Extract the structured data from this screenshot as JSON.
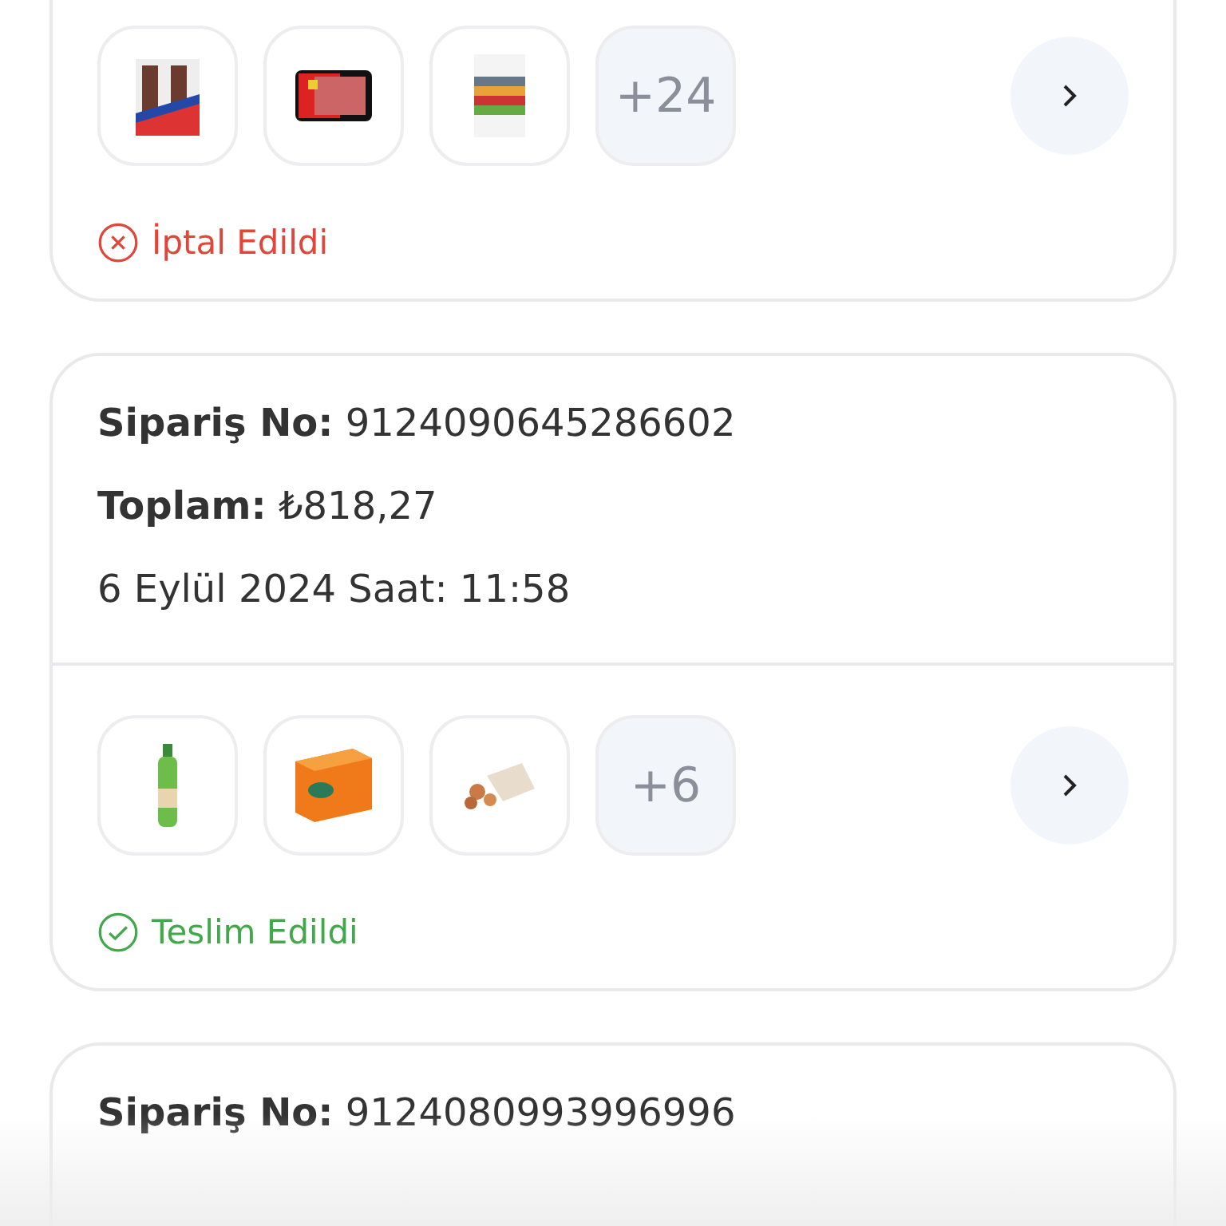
{
  "orders": [
    {
      "more": "+24",
      "status": {
        "kind": "cancelled",
        "label": "İptal Edildi"
      }
    },
    {
      "order_no": "**Sipariş No:** 9124090645286602",
      "total": "**Toplam:** ₺818,27",
      "date": "6 Eylül 2024 Saat: 11:58",
      "more": "+6",
      "status": {
        "kind": "delivered",
        "label": "Teslim Edildi"
      }
    },
    {
      "order_no": "**Sipariş No:** 9124080993996996"
    }
  ]
}
